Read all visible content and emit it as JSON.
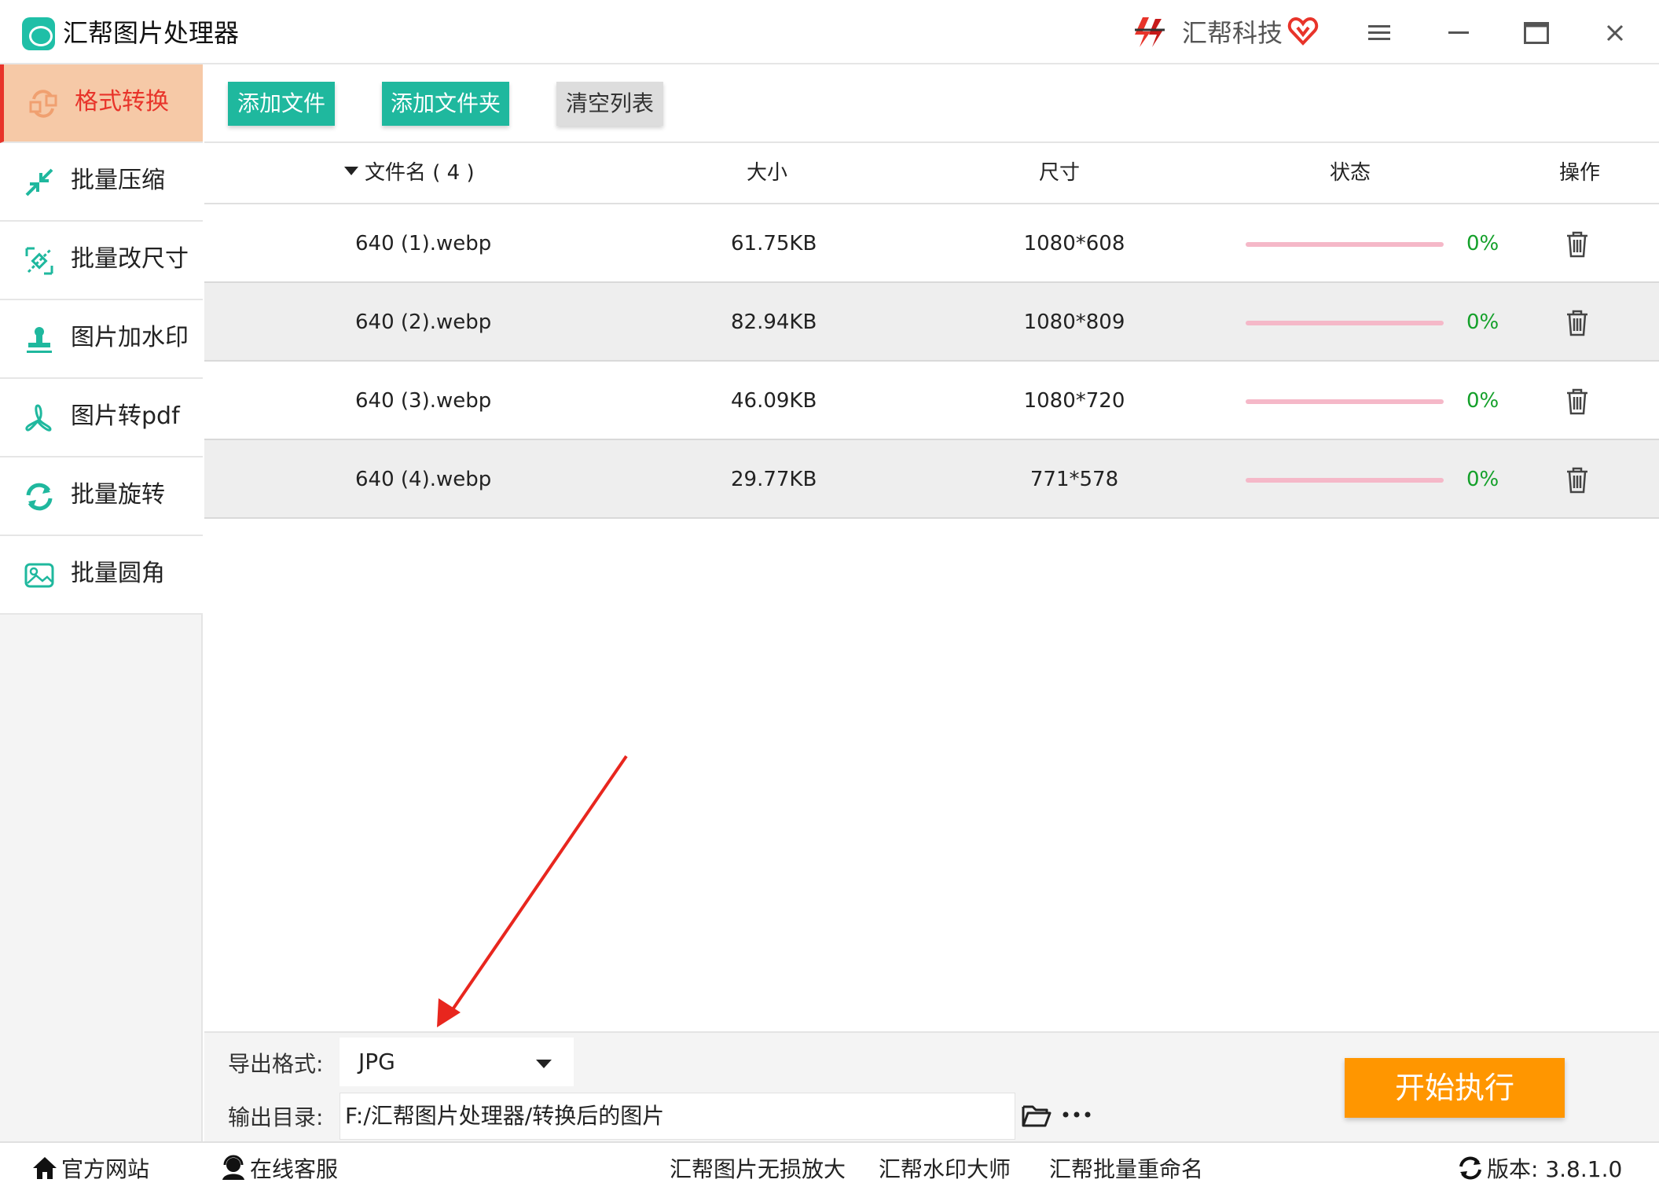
{
  "app": {
    "title": "汇帮图片处理器",
    "brand_name": "汇帮科技"
  },
  "sidebar": {
    "items": [
      {
        "label": "格式转换",
        "icon": "format-convert-icon",
        "active": true
      },
      {
        "label": "批量压缩",
        "icon": "compress-icon",
        "active": false
      },
      {
        "label": "批量改尺寸",
        "icon": "resize-icon",
        "active": false
      },
      {
        "label": "图片加水印",
        "icon": "watermark-stamp-icon",
        "active": false
      },
      {
        "label": "图片转pdf",
        "icon": "pdf-icon",
        "active": false
      },
      {
        "label": "批量旋转",
        "icon": "rotate-icon",
        "active": false
      },
      {
        "label": "批量圆角",
        "icon": "image-corner-icon",
        "active": false
      }
    ]
  },
  "toolbar": {
    "add_file": "添加文件",
    "add_folder": "添加文件夹",
    "clear_list": "清空列表"
  },
  "table": {
    "headers": {
      "name": "文件名 ( 4 )",
      "size": "大小",
      "dimensions": "尺寸",
      "status": "状态",
      "action": "操作"
    },
    "rows": [
      {
        "name": "640 (1).webp",
        "size": "61.75KB",
        "dimensions": "1080*608",
        "progress": 0,
        "status": "0%"
      },
      {
        "name": "640 (2).webp",
        "size": "82.94KB",
        "dimensions": "1080*809",
        "progress": 0,
        "status": "0%"
      },
      {
        "name": "640 (3).webp",
        "size": "46.09KB",
        "dimensions": "1080*720",
        "progress": 0,
        "status": "0%"
      },
      {
        "name": "640 (4).webp",
        "size": "29.77KB",
        "dimensions": "771*578",
        "progress": 0,
        "status": "0%"
      }
    ]
  },
  "settings": {
    "format_label": "导出格式:",
    "format_value": "JPG",
    "dir_label": "输出目录:",
    "dir_value": "F:/汇帮图片处理器/转换后的图片",
    "start": "开始执行"
  },
  "footer": {
    "official_site": "官方网站",
    "online_service": "在线客服",
    "upscale": "汇帮图片无损放大",
    "watermark_master": "汇帮水印大师",
    "batch_rename": "汇帮批量重命名",
    "version": "版本:  3.8.1.0"
  },
  "colors": {
    "accent_green": "#1fb89e",
    "active_red": "#e8342a",
    "active_bg": "#f6c9a7",
    "start_orange": "#ff9600",
    "progress_track": "#f5b8c8",
    "percent_green": "#14a02a"
  }
}
